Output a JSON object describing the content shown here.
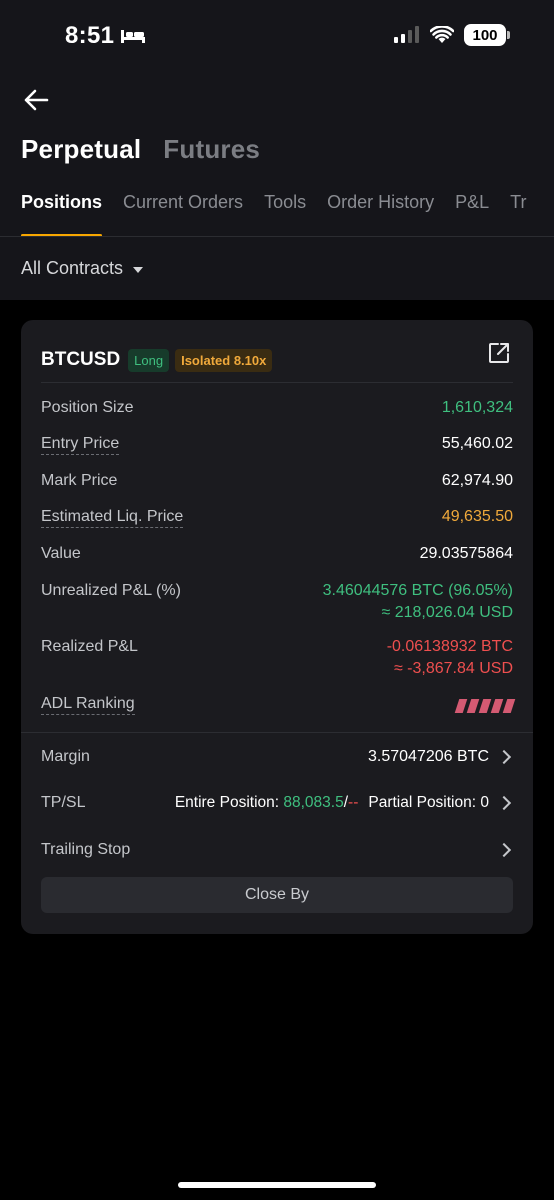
{
  "status_bar": {
    "time": "8:51",
    "battery": "100"
  },
  "categories": [
    {
      "label": "Perpetual",
      "active": true
    },
    {
      "label": "Futures",
      "active": false
    }
  ],
  "tabs": [
    {
      "label": "Positions",
      "active": true
    },
    {
      "label": "Current Orders"
    },
    {
      "label": "Tools"
    },
    {
      "label": "Order History"
    },
    {
      "label": "P&L"
    },
    {
      "label": "Tr"
    }
  ],
  "filter": {
    "label": "All Contracts"
  },
  "position": {
    "symbol": "BTCUSD",
    "side_badge": "Long",
    "margin_badge": "Isolated 8.10x",
    "rows": {
      "position_size": {
        "label": "Position Size",
        "value": "1,610,324"
      },
      "entry_price": {
        "label": "Entry Price",
        "value": "55,460.02"
      },
      "mark_price": {
        "label": "Mark Price",
        "value": "62,974.90"
      },
      "liq_price": {
        "label": "Estimated Liq. Price",
        "value": "49,635.50"
      },
      "value": {
        "label": "Value",
        "value": "29.03575864"
      },
      "unrealized_pnl": {
        "label": "Unrealized P&L (%)",
        "value": "3.46044576 BTC (96.05%)",
        "sub": "≈ 218,026.04 USD"
      },
      "realized_pnl": {
        "label": "Realized P&L",
        "value": "-0.06138932 BTC",
        "sub": "≈ -3,867.84 USD"
      },
      "adl": {
        "label": "ADL Ranking",
        "level": 5,
        "max": 5
      }
    },
    "margin": {
      "label": "Margin",
      "value": "3.57047206 BTC"
    },
    "tpsl": {
      "label": "TP/SL",
      "entire_label": "Entire Position:",
      "entire_tp": "88,083.5",
      "entire_sep": "/",
      "entire_sl": "--",
      "partial_label": "Partial Position:",
      "partial_value": "0"
    },
    "trailing_stop": {
      "label": "Trailing Stop"
    },
    "close_button": "Close By"
  },
  "colors": {
    "accent": "#f7a600",
    "green": "#3fbf7f",
    "red": "#ef4f4f",
    "orange": "#f0a93b",
    "adl": "#d45a72"
  }
}
